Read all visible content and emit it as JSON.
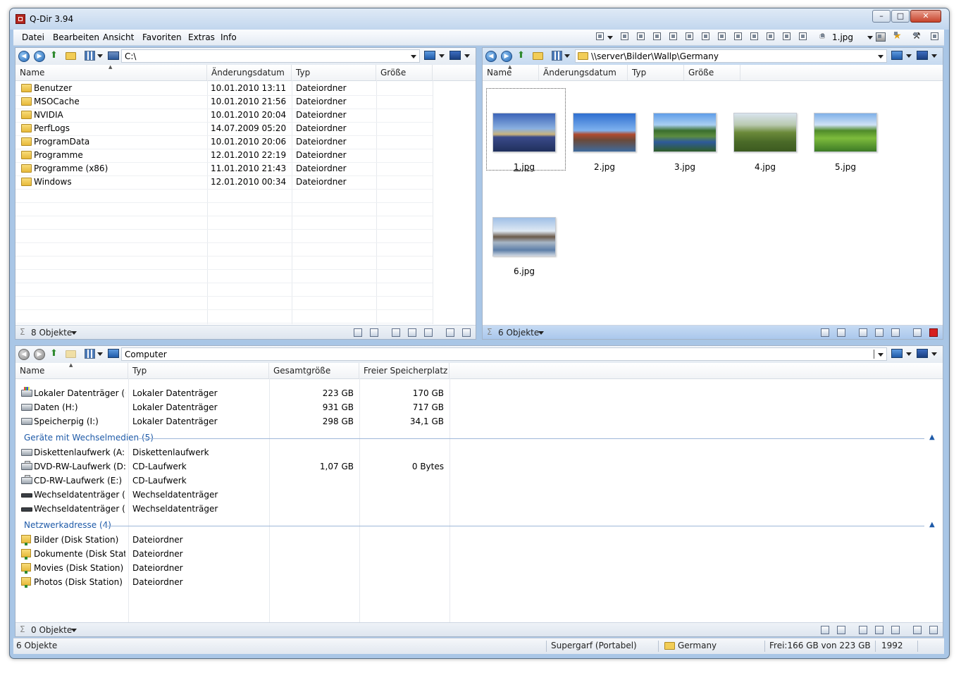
{
  "window": {
    "title": "Q-Dir 3.94"
  },
  "menu": [
    "Datei",
    "Bearbeiten",
    "Ansicht",
    "Favoriten",
    "Extras",
    "Info"
  ],
  "toolbar": {
    "current_file": "1.jpg"
  },
  "pane1": {
    "path": "C:\\",
    "columns": [
      "Name",
      "Änderungsdatum",
      "Typ",
      "Größe"
    ],
    "rows": [
      [
        "Benutzer",
        "10.01.2010 13:11",
        "Dateiordner",
        ""
      ],
      [
        "MSOCache",
        "10.01.2010 21:56",
        "Dateiordner",
        ""
      ],
      [
        "NVIDIA",
        "10.01.2010 20:04",
        "Dateiordner",
        ""
      ],
      [
        "PerfLogs",
        "14.07.2009 05:20",
        "Dateiordner",
        ""
      ],
      [
        "ProgramData",
        "10.01.2010 20:06",
        "Dateiordner",
        ""
      ],
      [
        "Programme",
        "12.01.2010 22:19",
        "Dateiordner",
        ""
      ],
      [
        "Programme (x86)",
        "11.01.2010 21:43",
        "Dateiordner",
        ""
      ],
      [
        "Windows",
        "12.01.2010 00:34",
        "Dateiordner",
        ""
      ]
    ],
    "status": "8 Objekte"
  },
  "pane2": {
    "path": "\\\\server\\Bilder\\Wallp\\Germany",
    "columns": [
      "Name",
      "Änderungsdatum",
      "Typ",
      "Größe"
    ],
    "thumbnails": [
      "1.jpg",
      "2.jpg",
      "3.jpg",
      "4.jpg",
      "5.jpg",
      "6.jpg"
    ],
    "status": "6 Objekte"
  },
  "pane3": {
    "path": "Computer",
    "columns": [
      "Name",
      "Typ",
      "Gesamtgröße",
      "Freier Speicherplatz"
    ],
    "drives": [
      [
        "Lokaler Datenträger (C:)",
        "Lokaler Datenträger",
        "223 GB",
        "170 GB"
      ],
      [
        "Daten (H:)",
        "Lokaler Datenträger",
        "931 GB",
        "717 GB"
      ],
      [
        "Speicherpig (I:)",
        "Lokaler Datenträger",
        "298 GB",
        "34,1 GB"
      ]
    ],
    "group_removable": "Geräte mit Wechselmedien (5)",
    "removable": [
      [
        "Diskettenlaufwerk (A:)",
        "Diskettenlaufwerk",
        "",
        ""
      ],
      [
        "DVD-RW-Laufwerk (D:)...",
        "CD-Laufwerk",
        "1,07 GB",
        "0 Bytes"
      ],
      [
        "CD-RW-Laufwerk (E:)",
        "CD-Laufwerk",
        "",
        ""
      ],
      [
        "Wechseldatenträger (F:)",
        "Wechseldatenträger",
        "",
        ""
      ],
      [
        "Wechseldatenträger (G:)",
        "Wechseldatenträger",
        "",
        ""
      ]
    ],
    "group_network": "Netzwerkadresse (4)",
    "network": [
      [
        "Bilder (Disk Station)",
        "Dateiordner"
      ],
      [
        "Dokumente (Disk Stati...",
        "Dateiordner"
      ],
      [
        "Movies (Disk Station)",
        "Dateiordner"
      ],
      [
        "Photos (Disk Station)",
        "Dateiordner"
      ]
    ],
    "status": "0 Objekte"
  },
  "statusbar": {
    "objects": "6 Objekte",
    "user": "Supergarf (Portabel)",
    "folder": "Germany",
    "free": "Frei:166 GB von 223 GB",
    "number": "1992"
  }
}
